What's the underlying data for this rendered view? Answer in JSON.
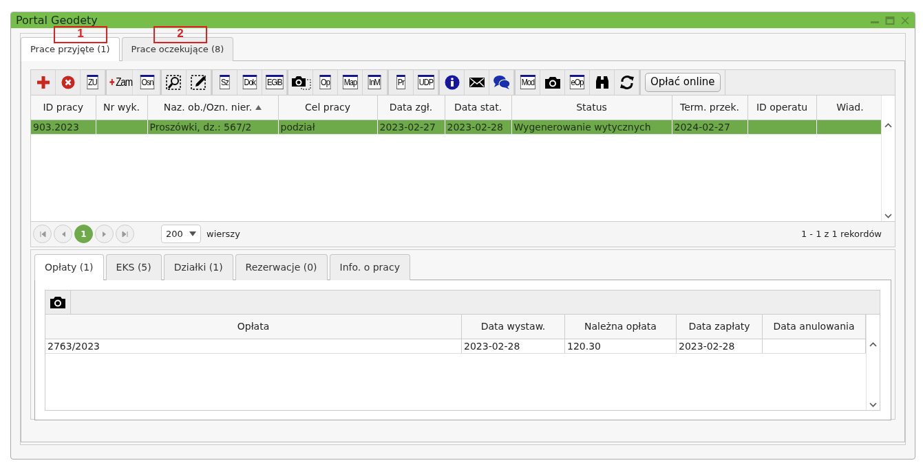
{
  "window": {
    "title": "Portal Geodety"
  },
  "annotations": [
    {
      "label": "1"
    },
    {
      "label": "2"
    }
  ],
  "tabs": [
    {
      "label": "Prace przyjęte (1)",
      "selected": true
    },
    {
      "label": "Prace oczekujące (8)",
      "selected": false
    }
  ],
  "toolbar": {
    "groups": [
      [
        {
          "kind": "plus"
        },
        {
          "kind": "cancel"
        },
        {
          "kind": "label",
          "text": "ZU"
        }
      ],
      [
        {
          "kind": "add-label",
          "text": "Zam"
        },
        {
          "kind": "label",
          "text": "Osn"
        }
      ],
      [
        {
          "kind": "zoom-select"
        },
        {
          "kind": "edit-select"
        }
      ],
      [
        {
          "kind": "label",
          "text": "Sz"
        },
        {
          "kind": "label",
          "text": "Dok"
        },
        {
          "kind": "label",
          "text": "EGiB"
        }
      ],
      [
        {
          "kind": "camera-select"
        },
        {
          "kind": "label",
          "text": "Op"
        },
        {
          "kind": "label",
          "text": "Map"
        },
        {
          "kind": "label",
          "text": "InM"
        }
      ],
      [
        {
          "kind": "label",
          "text": "Pr"
        },
        {
          "kind": "label",
          "text": "UDP"
        }
      ],
      [
        {
          "kind": "info"
        },
        {
          "kind": "mail"
        },
        {
          "kind": "chat"
        }
      ],
      [
        {
          "kind": "label",
          "text": "Mod"
        },
        {
          "kind": "camera"
        },
        {
          "kind": "label",
          "text": "eOp"
        },
        {
          "kind": "binoculars"
        },
        {
          "kind": "refresh"
        }
      ]
    ],
    "button": "Opłać online"
  },
  "table": {
    "columns": [
      {
        "label": "ID pracy"
      },
      {
        "label": "Nr wyk."
      },
      {
        "label": "Naz. ob./Ozn. nier.",
        "sorted_ascending": true
      },
      {
        "label": "Cel pracy"
      },
      {
        "label": "Data zgł."
      },
      {
        "label": "Data stat."
      },
      {
        "label": "Status"
      },
      {
        "label": "Term. przek."
      },
      {
        "label": "ID operatu"
      },
      {
        "label": "Wiad."
      }
    ],
    "rows": [
      {
        "selected": true,
        "cells": [
          "903.2023",
          "",
          "Proszówki, dz.: 567/2",
          "podział",
          "2023-02-27",
          "2023-02-28",
          "Wygenerowanie wytycznych",
          "2024-02-27",
          "",
          ""
        ]
      }
    ]
  },
  "pager": {
    "pages": [
      {
        "label": "1",
        "selected": true
      }
    ],
    "page_size": "200",
    "page_size_label": "wierszy",
    "summary": "1 - 1 z 1 rekordów"
  },
  "detail_tabs": [
    {
      "label": "Opłaty (1)",
      "selected": true
    },
    {
      "label": "EKS (5)",
      "selected": false
    },
    {
      "label": "Działki (1)",
      "selected": false
    },
    {
      "label": "Rezerwacje (0)",
      "selected": false
    },
    {
      "label": "Info. o pracy",
      "selected": false
    }
  ],
  "fees": {
    "columns": [
      {
        "label": "Opłata"
      },
      {
        "label": "Data wystaw."
      },
      {
        "label": "Należna opłata"
      },
      {
        "label": "Data zapłaty"
      },
      {
        "label": "Data anulowania"
      }
    ],
    "rows": [
      {
        "cells": [
          "2763/2023",
          "2023-02-28",
          "120.30",
          "2023-02-28",
          ""
        ]
      }
    ]
  }
}
